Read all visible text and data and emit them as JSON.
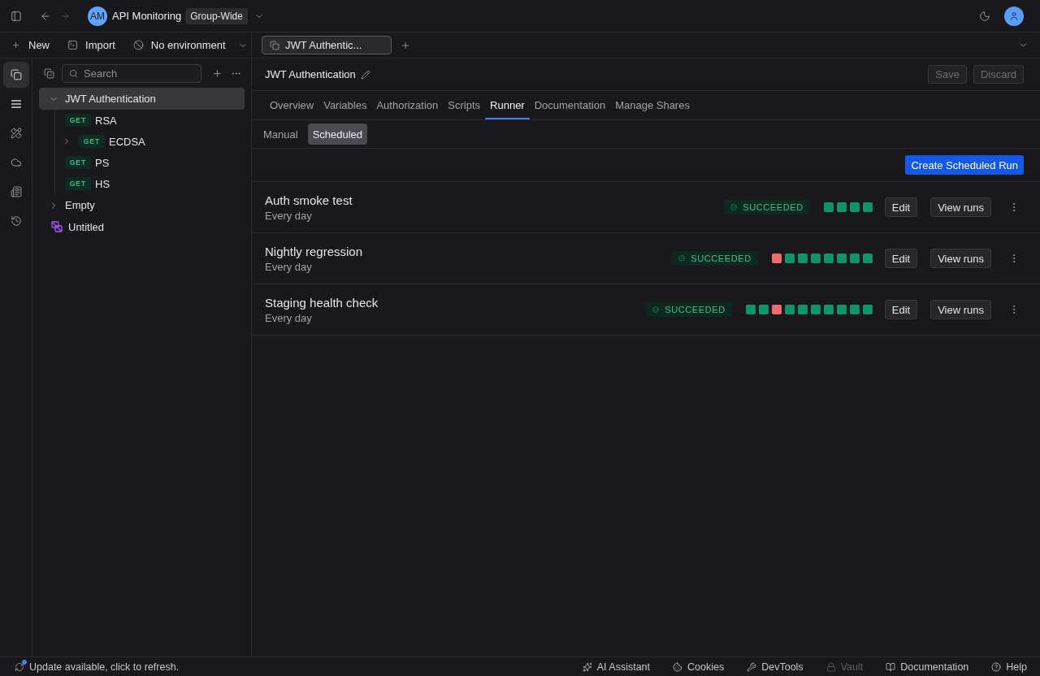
{
  "top_bar": {
    "navigation": [
      {
        "kind": "back",
        "disabled": false
      },
      {
        "kind": "forward",
        "disabled": true
      }
    ],
    "workspace": {
      "initials": "AM",
      "name": "API Monitoring",
      "badge": "Group-Wide"
    }
  },
  "sidebar_toolbar": {
    "new": "New",
    "import": "Import",
    "environment": "No environment"
  },
  "editor_tabs": [
    {
      "label": "JWT Authentic...",
      "selected": true
    }
  ],
  "rail": [
    {
      "selected": true
    },
    {
      "selected": false
    },
    {
      "selected": false
    },
    {
      "selected": false
    },
    {
      "selected": false
    },
    {
      "selected": false
    }
  ],
  "sidebar": {
    "search": {
      "placeholder": "Search"
    },
    "tree": [
      {
        "kind": "folder",
        "label": "JWT Authentication",
        "selected": true,
        "expanded": true,
        "children": [
          {
            "kind": "request",
            "method": "GET",
            "label": "RSA",
            "selected": false
          },
          {
            "kind": "request",
            "method": "GET",
            "label": "ECDSA",
            "selected": false,
            "expanded": false
          },
          {
            "kind": "request",
            "method": "GET",
            "label": "PS",
            "selected": false
          },
          {
            "kind": "request",
            "method": "GET",
            "label": "HS",
            "selected": false
          }
        ]
      },
      {
        "kind": "folder",
        "label": "Empty",
        "selected": false,
        "expanded": false
      },
      {
        "kind": "other",
        "label": "Untitled",
        "selected": false
      }
    ]
  },
  "collection": {
    "title": "JWT Authentication",
    "actions": [
      {
        "label": "Save",
        "disabled": true
      },
      {
        "label": "Discard",
        "disabled": true
      }
    ]
  },
  "tabs": [
    {
      "label": "Overview",
      "selected": false
    },
    {
      "label": "Variables",
      "selected": false
    },
    {
      "label": "Authorization",
      "selected": false
    },
    {
      "label": "Scripts",
      "selected": false
    },
    {
      "label": "Runner",
      "selected": true
    },
    {
      "label": "Documentation",
      "selected": false
    },
    {
      "label": "Manage Shares",
      "selected": false
    }
  ],
  "runner_modes": [
    {
      "label": "Manual",
      "selected": false
    },
    {
      "label": "Scheduled",
      "selected": true
    }
  ],
  "create_button": "Create Scheduled Run",
  "schedules": [
    {
      "name": "Auth smoke test",
      "frequency": "Every day",
      "status": "SUCCEEDED",
      "runs": [
        {
          "color": "#10936a"
        },
        {
          "color": "#10936a"
        },
        {
          "color": "#10936a"
        },
        {
          "color": "#10936a"
        }
      ],
      "actions": [
        "Edit",
        "View runs"
      ]
    },
    {
      "name": "Nightly regression",
      "frequency": "Every day",
      "status": "SUCCEEDED",
      "runs": [
        {
          "color": "#f06b6b"
        },
        {
          "color": "#10936a"
        },
        {
          "color": "#10936a"
        },
        {
          "color": "#10936a"
        },
        {
          "color": "#10936a"
        },
        {
          "color": "#10936a"
        },
        {
          "color": "#10936a"
        },
        {
          "color": "#10936a"
        }
      ],
      "actions": [
        "Edit",
        "View runs"
      ]
    },
    {
      "name": "Staging health check",
      "frequency": "Every day",
      "status": "SUCCEEDED",
      "runs": [
        {
          "color": "#10936a"
        },
        {
          "color": "#10936a"
        },
        {
          "color": "#f06b6b"
        },
        {
          "color": "#10936a"
        },
        {
          "color": "#10936a"
        },
        {
          "color": "#10936a"
        },
        {
          "color": "#10936a"
        },
        {
          "color": "#10936a"
        },
        {
          "color": "#10936a"
        },
        {
          "color": "#10936a"
        }
      ],
      "actions": [
        "Edit",
        "View runs"
      ]
    }
  ],
  "status_bar": {
    "update": "Update available, click to refresh.",
    "items": [
      {
        "label": "AI Assistant",
        "disabled": false
      },
      {
        "label": "Cookies",
        "disabled": false
      },
      {
        "label": "DevTools",
        "disabled": false
      },
      {
        "label": "Vault",
        "disabled": true
      },
      {
        "label": "Documentation",
        "disabled": false
      },
      {
        "label": "Help",
        "disabled": false
      }
    ]
  }
}
